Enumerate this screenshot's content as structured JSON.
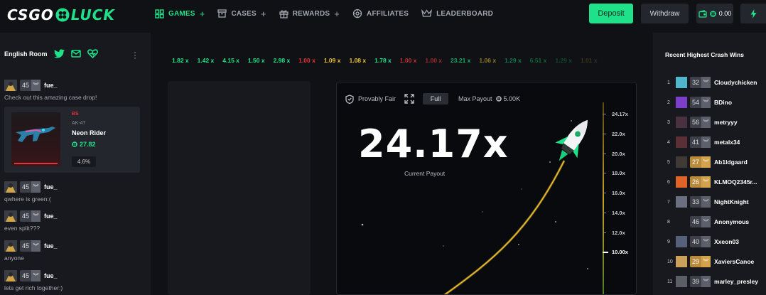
{
  "brand": {
    "part1": "CSGO",
    "part2": "LUCK",
    "accent": "#1fe18a"
  },
  "nav": [
    {
      "label": "GAMES",
      "plus": "+",
      "icon": "grid-icon",
      "active": true
    },
    {
      "label": "CASES",
      "plus": "+",
      "icon": "box-icon"
    },
    {
      "label": "REWARDS",
      "plus": "+",
      "icon": "gift-icon"
    },
    {
      "label": "AFFILIATES",
      "plus": "",
      "icon": "gear-icon"
    },
    {
      "label": "LEADERBOARD",
      "plus": "",
      "icon": "crown-icon"
    }
  ],
  "header": {
    "deposit": "Deposit",
    "withdraw": "Withdraw",
    "balance": "0.00"
  },
  "chat": {
    "room": "English Room",
    "messages": [
      {
        "level": "45",
        "user": "fue_",
        "text": "Check out this amazing case drop!"
      },
      {
        "level": "45",
        "user": "fue_",
        "text": "qwhere is green:("
      },
      {
        "level": "45",
        "user": "fue_",
        "text": "even split???"
      },
      {
        "level": "45",
        "user": "fue_",
        "text": "anyone"
      },
      {
        "level": "45",
        "user": "fue_",
        "text": "lets get rich together:)"
      }
    ],
    "drop": {
      "wear": "BS",
      "weapon": "AK-47",
      "skin": "Neon Rider",
      "price": "27.82",
      "chance": "4.6%"
    }
  },
  "history": [
    {
      "v": "1.82 x",
      "c": "#1fe18a"
    },
    {
      "v": "1.42 x",
      "c": "#1fe18a"
    },
    {
      "v": "4.15 x",
      "c": "#1fe18a"
    },
    {
      "v": "1.50 x",
      "c": "#1fe18a"
    },
    {
      "v": "2.98 x",
      "c": "#1fe18a"
    },
    {
      "v": "1.00 x",
      "c": "#e5333b"
    },
    {
      "v": "1.09 x",
      "c": "#e8c23a"
    },
    {
      "v": "1.08 x",
      "c": "#e8c23a"
    },
    {
      "v": "1.78 x",
      "c": "#1fe18a"
    },
    {
      "v": "1.00 x",
      "c": "#c0333a"
    },
    {
      "v": "1.00 x",
      "c": "#9c2b30"
    },
    {
      "v": "23.21 x",
      "c": "#1aa866"
    },
    {
      "v": "1.06 x",
      "c": "#8f7a2a"
    },
    {
      "v": "1.29 x",
      "c": "#147a4b"
    },
    {
      "v": "6.51 x",
      "c": "#106239"
    },
    {
      "v": "1.29 x",
      "c": "#0c4a2c"
    },
    {
      "v": "1.01 x",
      "c": "#3b3320"
    }
  ],
  "game": {
    "provably_fair": "Provably Fair",
    "full": "Full",
    "max_payout_label": "Max Payout",
    "max_payout": "5.00K",
    "multiplier": "24.17x",
    "current_label": "Current Payout",
    "axis_ticks": [
      "24.17x",
      "22.0x",
      "20.0x",
      "18.0x",
      "16.0x",
      "14.0x",
      "12.0x",
      "10.00x"
    ]
  },
  "wins": {
    "title": "Recent Highest Crash Wins",
    "rows": [
      {
        "rank": "1",
        "level": "32",
        "name": "Cloudychicken",
        "gold": false,
        "av": "#4fb7c9"
      },
      {
        "rank": "2",
        "level": "54",
        "name": "BDino",
        "gold": false,
        "av": "#7b3fc9"
      },
      {
        "rank": "3",
        "level": "56",
        "name": "metryyy",
        "gold": false,
        "av": "#4a3140"
      },
      {
        "rank": "4",
        "level": "41",
        "name": "metalx34",
        "gold": false,
        "av": "#5a3036"
      },
      {
        "rank": "5",
        "level": "27",
        "name": "Ab1ldgaard",
        "gold": true,
        "av": "#3f3a36"
      },
      {
        "rank": "6",
        "level": "26",
        "name": "KLMOQ2345r...",
        "gold": true,
        "av": "#e0642a"
      },
      {
        "rank": "7",
        "level": "33",
        "name": "NightKnight",
        "gold": false,
        "av": "#6a7080"
      },
      {
        "rank": "8",
        "level": "46",
        "name": "Anonymous",
        "gold": false,
        "av": "#17191e"
      },
      {
        "rank": "9",
        "level": "40",
        "name": "Xxeon03",
        "gold": false,
        "av": "#56607a"
      },
      {
        "rank": "10",
        "level": "29",
        "name": "XaviersCanoe",
        "gold": true,
        "av": "#c9a15a"
      },
      {
        "rank": "11",
        "level": "39",
        "name": "marley_presley",
        "gold": false,
        "av": "#5a5f66"
      }
    ]
  }
}
